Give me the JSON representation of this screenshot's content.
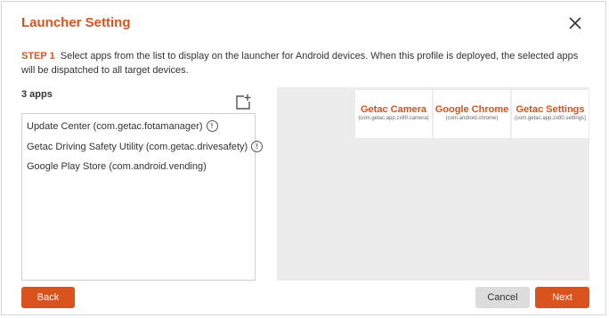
{
  "dialog": {
    "title": "Launcher Setting",
    "close_icon": "close-icon",
    "step_label": "STEP 1",
    "step_text": "Select apps from the list to display on the launcher for Android devices. When this profile is deployed, the selected apps will be dispatched to all target devices."
  },
  "app_list": {
    "count_label": "3 apps",
    "add_icon": "add-app-icon",
    "items": [
      {
        "label": "Update Center (com.getac.fotamanager)",
        "has_info": true
      },
      {
        "label": "Getac Driving Safety Utility (com.getac.drivesafety)",
        "has_info": true
      },
      {
        "label": "Google Play Store (com.android.vending)",
        "has_info": false
      }
    ],
    "info_icon": "info-icon"
  },
  "launcher_preview": {
    "tiles": [
      {
        "name": "Getac Camera",
        "package": "(com.getac.app.zx80.camera)"
      },
      {
        "name": "Google Chrome",
        "package": "(com.android.chrome)"
      },
      {
        "name": "Getac Settings",
        "package": "(com.getac.app.zx80.settings)"
      }
    ]
  },
  "footer": {
    "back_label": "Back",
    "cancel_label": "Cancel",
    "next_label": "Next"
  },
  "colors": {
    "accent": "#d9531e",
    "preview_bg": "#ececec",
    "secondary_button": "#dcdcdc"
  }
}
